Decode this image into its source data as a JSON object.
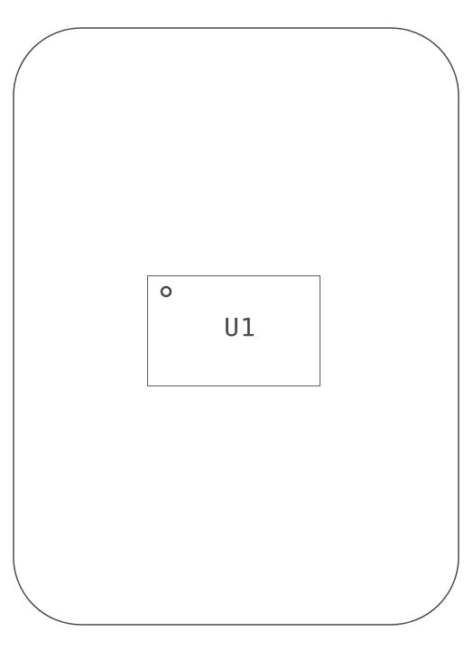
{
  "board": {
    "outline_shape": "rounded-rectangle",
    "stroke_color": "#4a4a4a",
    "background_color": "#ffffff"
  },
  "component": {
    "designator": "U1",
    "pin1_marker": "circle",
    "stroke_color": "#5c5c5c",
    "text_color": "#4a4a4a"
  }
}
